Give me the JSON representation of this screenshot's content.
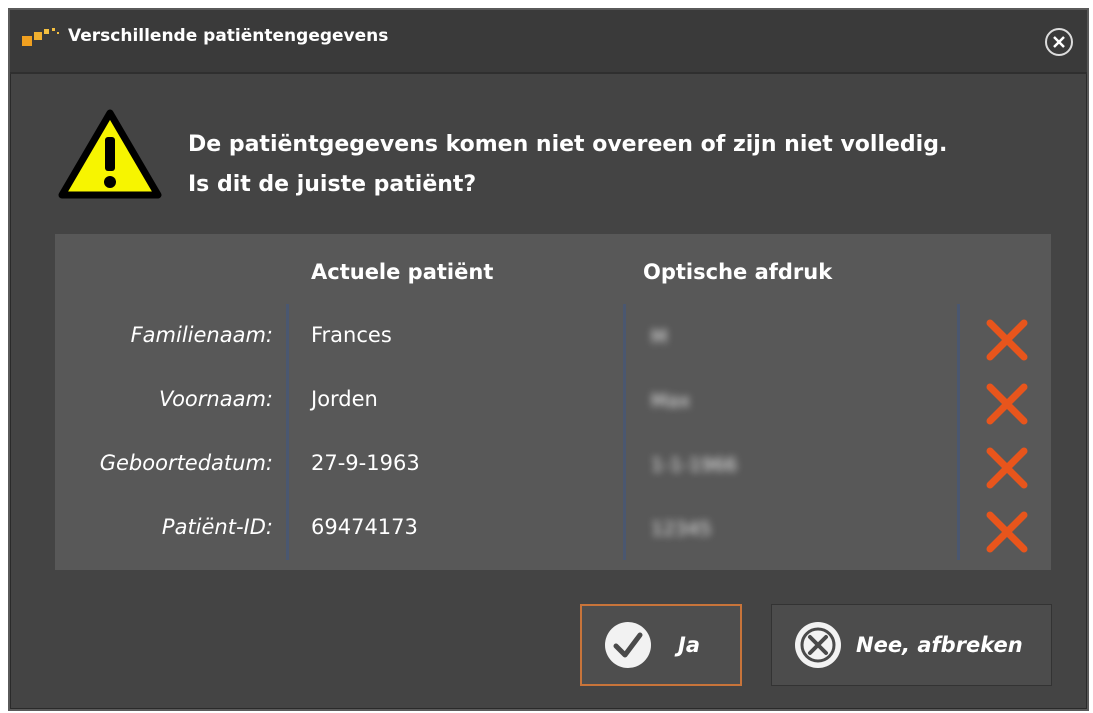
{
  "dialog": {
    "title": "Verschillende patiëntengegevens",
    "message_line1": "De patiëntgegevens komen niet overeen of zijn niet volledig.",
    "message_line2": "Is dit de juiste patiënt?",
    "icons": {
      "close": "close-circle-icon",
      "warning": "warning-triangle-icon",
      "mismatch": "x-mark-icon",
      "app": "app-logo-icon"
    },
    "colors": {
      "background": "#444444",
      "warning_yellow": "#f7f500",
      "mismatch_orange": "#e8551c",
      "accent_border": "#c8743a"
    }
  },
  "table": {
    "headers": [
      "Actuele patiënt",
      "Optische afdruk"
    ],
    "rows": [
      {
        "label": "Familienaam:",
        "current": "Frances",
        "optical": "M"
      },
      {
        "label": "Voornaam:",
        "current": "Jorden",
        "optical": "Max"
      },
      {
        "label": "Geboortedatum:",
        "current": "27-9-1963",
        "optical": "1-1-1966"
      },
      {
        "label": "Patiënt-ID:",
        "current": "69474173",
        "optical": "12345"
      }
    ]
  },
  "buttons": {
    "yes": "Ja",
    "no": "Nee, afbreken"
  }
}
